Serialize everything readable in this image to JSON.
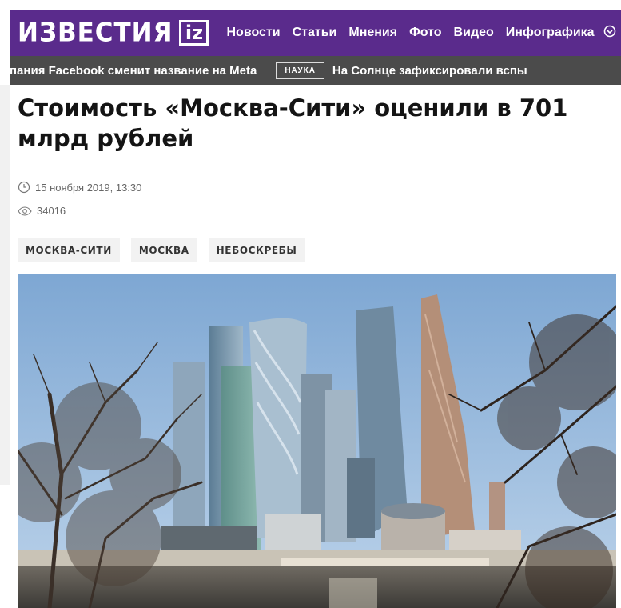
{
  "header": {
    "logo_text": "ИЗВЕСТИЯ",
    "logo_badge": "iz",
    "nav": [
      "Новости",
      "Статьи",
      "Мнения",
      "Фото",
      "Видео",
      "Инфографика"
    ],
    "brand_color": "#5a2b8c"
  },
  "ticker": {
    "headline_1": "пания Facebook сменит название на Meta",
    "tag": "НАУКА",
    "headline_2": "На Солнце зафиксировали вспы"
  },
  "article": {
    "title": "Стоимость «Москва-Сити» оценили в 701 млрд рублей",
    "date": "15 ноября 2019, 13:30",
    "views": "34016",
    "tags": [
      "МОСКВА-СИТИ",
      "МОСКВА",
      "НЕБОСКРЕБЫ"
    ]
  },
  "icons": {
    "date": "clock-icon",
    "views": "eye-icon",
    "more": "chevron-down-icon"
  }
}
